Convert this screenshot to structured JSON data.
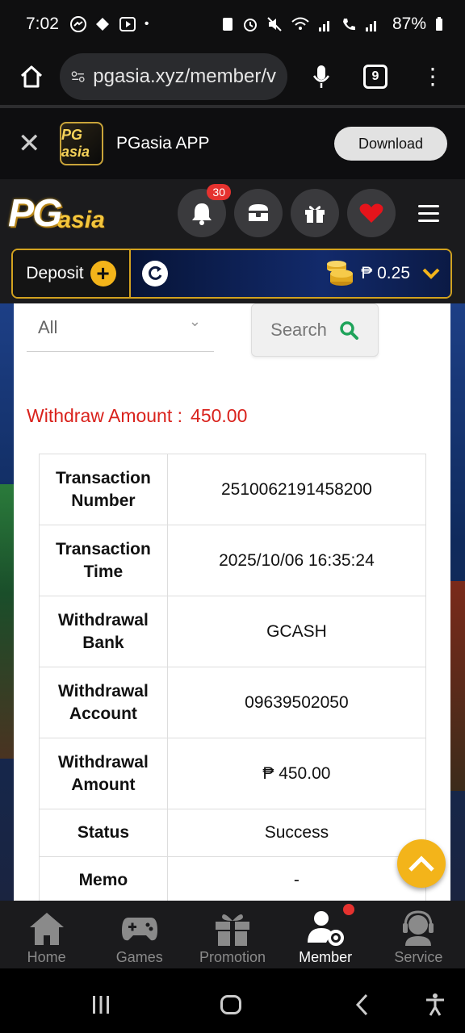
{
  "status_bar": {
    "time": "7:02",
    "battery": "87%"
  },
  "browser": {
    "url": "pgasia.xyz/member/v",
    "tab_count": "9"
  },
  "app_banner": {
    "app_name": "PGasia APP",
    "download_label": "Download",
    "logo_text": "PG asia"
  },
  "site_header": {
    "logo_main": "PG",
    "logo_sub": "asia",
    "notification_count": "30"
  },
  "wallet": {
    "deposit_label": "Deposit",
    "balance": "₱ 0.25"
  },
  "filter": {
    "selected": "All",
    "search_label": "Search"
  },
  "withdraw_summary": {
    "label": "Withdraw Amount :",
    "value": "450.00"
  },
  "details": [
    {
      "label": "Transaction Number",
      "value": "2510062191458200"
    },
    {
      "label": "Transaction Time",
      "value": "2025/10/06 16:35:24"
    },
    {
      "label": "Withdrawal Bank",
      "value": "GCASH"
    },
    {
      "label": "Withdrawal Account",
      "value": "09639502050"
    },
    {
      "label": "Withdrawal Amount",
      "value": "₱ 450.00"
    },
    {
      "label": "Status",
      "value": "Success"
    },
    {
      "label": "Memo",
      "value": "-"
    }
  ],
  "bottom_nav": [
    {
      "label": "Home",
      "icon": "home-icon"
    },
    {
      "label": "Games",
      "icon": "gamepad-icon"
    },
    {
      "label": "Promotion",
      "icon": "gift-icon"
    },
    {
      "label": "Member",
      "icon": "member-icon",
      "active": true
    },
    {
      "label": "Service",
      "icon": "headset-icon"
    }
  ],
  "colors": {
    "accent_gold": "#f3b41a",
    "alert_red": "#d9221c",
    "header_dark": "#1b1b1d"
  }
}
